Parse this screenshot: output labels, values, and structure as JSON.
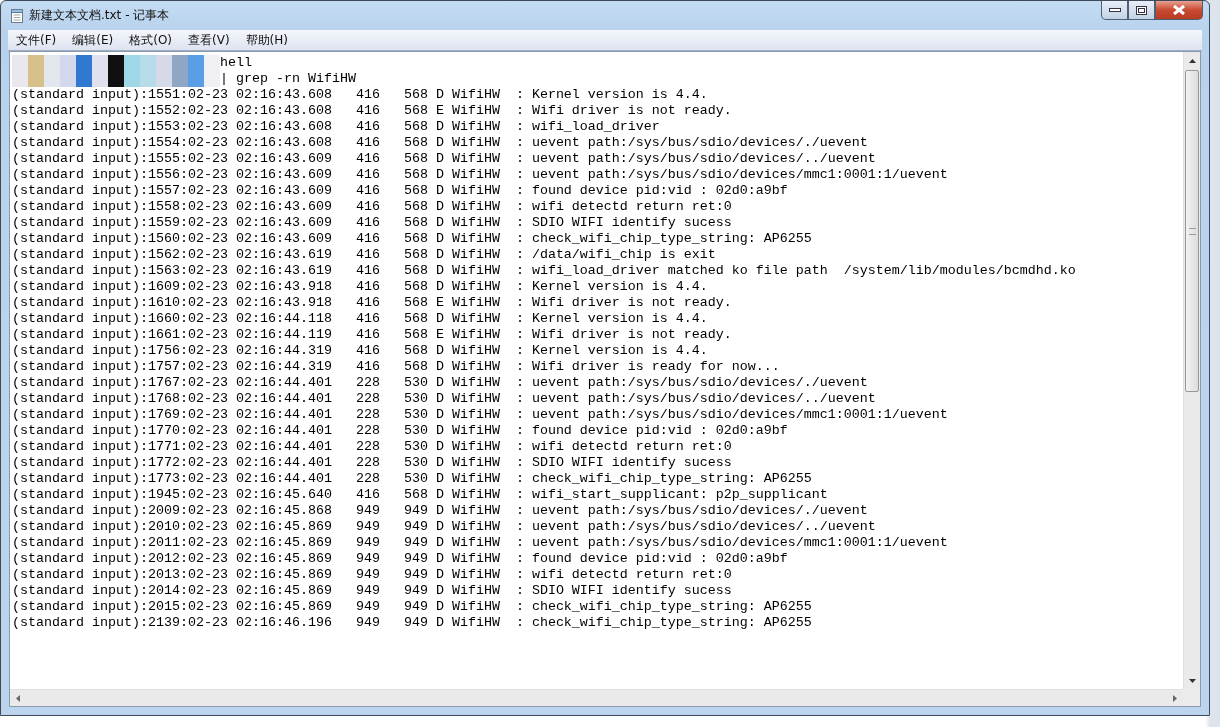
{
  "window": {
    "title": "新建文本文档.txt - 记事本"
  },
  "menu": [
    {
      "label": "文件(F)"
    },
    {
      "label": "编辑(E)"
    },
    {
      "label": "格式(O)"
    },
    {
      "label": "查看(V)"
    },
    {
      "label": "帮助(H)"
    }
  ],
  "editor": {
    "lines": [
      {
        "text": "hell",
        "redacted": true
      },
      {
        "text": "| grep -rn WifiHW",
        "redacted": true
      },
      {
        "text": "(standard input):1551:02-23 02:16:43.608   416   568 D WifiHW  : Kernel version is 4.4.",
        "redacted": false
      },
      {
        "text": "(standard input):1552:02-23 02:16:43.608   416   568 E WifiHW  : Wifi driver is not ready.",
        "redacted": false
      },
      {
        "text": "(standard input):1553:02-23 02:16:43.608   416   568 D WifiHW  : wifi_load_driver",
        "redacted": false
      },
      {
        "text": "(standard input):1554:02-23 02:16:43.608   416   568 D WifiHW  : uevent path:/sys/bus/sdio/devices/./uevent",
        "redacted": false
      },
      {
        "text": "(standard input):1555:02-23 02:16:43.609   416   568 D WifiHW  : uevent path:/sys/bus/sdio/devices/../uevent",
        "redacted": false
      },
      {
        "text": "(standard input):1556:02-23 02:16:43.609   416   568 D WifiHW  : uevent path:/sys/bus/sdio/devices/mmc1:0001:1/uevent",
        "redacted": false
      },
      {
        "text": "(standard input):1557:02-23 02:16:43.609   416   568 D WifiHW  : found device pid:vid : 02d0:a9bf",
        "redacted": false
      },
      {
        "text": "(standard input):1558:02-23 02:16:43.609   416   568 D WifiHW  : wifi detectd return ret:0",
        "redacted": false
      },
      {
        "text": "(standard input):1559:02-23 02:16:43.609   416   568 D WifiHW  : SDIO WIFI identify sucess",
        "redacted": false
      },
      {
        "text": "(standard input):1560:02-23 02:16:43.609   416   568 D WifiHW  : check_wifi_chip_type_string: AP6255",
        "redacted": false
      },
      {
        "text": "(standard input):1562:02-23 02:16:43.619   416   568 D WifiHW  : /data/wifi_chip is exit",
        "redacted": false
      },
      {
        "text": "(standard input):1563:02-23 02:16:43.619   416   568 D WifiHW  : wifi_load_driver matched ko file path  /system/lib/modules/bcmdhd.ko",
        "redacted": false
      },
      {
        "text": "(standard input):1609:02-23 02:16:43.918   416   568 D WifiHW  : Kernel version is 4.4.",
        "redacted": false
      },
      {
        "text": "(standard input):1610:02-23 02:16:43.918   416   568 E WifiHW  : Wifi driver is not ready.",
        "redacted": false
      },
      {
        "text": "(standard input):1660:02-23 02:16:44.118   416   568 D WifiHW  : Kernel version is 4.4.",
        "redacted": false
      },
      {
        "text": "(standard input):1661:02-23 02:16:44.119   416   568 E WifiHW  : Wifi driver is not ready.",
        "redacted": false
      },
      {
        "text": "(standard input):1756:02-23 02:16:44.319   416   568 D WifiHW  : Kernel version is 4.4.",
        "redacted": false
      },
      {
        "text": "(standard input):1757:02-23 02:16:44.319   416   568 D WifiHW  : Wifi driver is ready for now...",
        "redacted": false
      },
      {
        "text": "(standard input):1767:02-23 02:16:44.401   228   530 D WifiHW  : uevent path:/sys/bus/sdio/devices/./uevent",
        "redacted": false
      },
      {
        "text": "(standard input):1768:02-23 02:16:44.401   228   530 D WifiHW  : uevent path:/sys/bus/sdio/devices/../uevent",
        "redacted": false
      },
      {
        "text": "(standard input):1769:02-23 02:16:44.401   228   530 D WifiHW  : uevent path:/sys/bus/sdio/devices/mmc1:0001:1/uevent",
        "redacted": false
      },
      {
        "text": "(standard input):1770:02-23 02:16:44.401   228   530 D WifiHW  : found device pid:vid : 02d0:a9bf",
        "redacted": false
      },
      {
        "text": "(standard input):1771:02-23 02:16:44.401   228   530 D WifiHW  : wifi detectd return ret:0",
        "redacted": false
      },
      {
        "text": "(standard input):1772:02-23 02:16:44.401   228   530 D WifiHW  : SDIO WIFI identify sucess",
        "redacted": false
      },
      {
        "text": "(standard input):1773:02-23 02:16:44.401   228   530 D WifiHW  : check_wifi_chip_type_string: AP6255",
        "redacted": false
      },
      {
        "text": "(standard input):1945:02-23 02:16:45.640   416   568 D WifiHW  : wifi_start_supplicant: p2p_supplicant",
        "redacted": false
      },
      {
        "text": "(standard input):2009:02-23 02:16:45.868   949   949 D WifiHW  : uevent path:/sys/bus/sdio/devices/./uevent",
        "redacted": false
      },
      {
        "text": "(standard input):2010:02-23 02:16:45.869   949   949 D WifiHW  : uevent path:/sys/bus/sdio/devices/../uevent",
        "redacted": false
      },
      {
        "text": "(standard input):2011:02-23 02:16:45.869   949   949 D WifiHW  : uevent path:/sys/bus/sdio/devices/mmc1:0001:1/uevent",
        "redacted": false
      },
      {
        "text": "(standard input):2012:02-23 02:16:45.869   949   949 D WifiHW  : found device pid:vid : 02d0:a9bf",
        "redacted": false
      },
      {
        "text": "(standard input):2013:02-23 02:16:45.869   949   949 D WifiHW  : wifi detectd return ret:0",
        "redacted": false
      },
      {
        "text": "(standard input):2014:02-23 02:16:45.869   949   949 D WifiHW  : SDIO WIFI identify sucess",
        "redacted": false
      },
      {
        "text": "(standard input):2015:02-23 02:16:45.869   949   949 D WifiHW  : check_wifi_chip_type_string: AP6255",
        "redacted": false
      },
      {
        "text": "(standard input):2139:02-23 02:16:46.196   949   949 D WifiHW  : check_wifi_chip_type_string: AP6255",
        "redacted": false
      }
    ]
  }
}
